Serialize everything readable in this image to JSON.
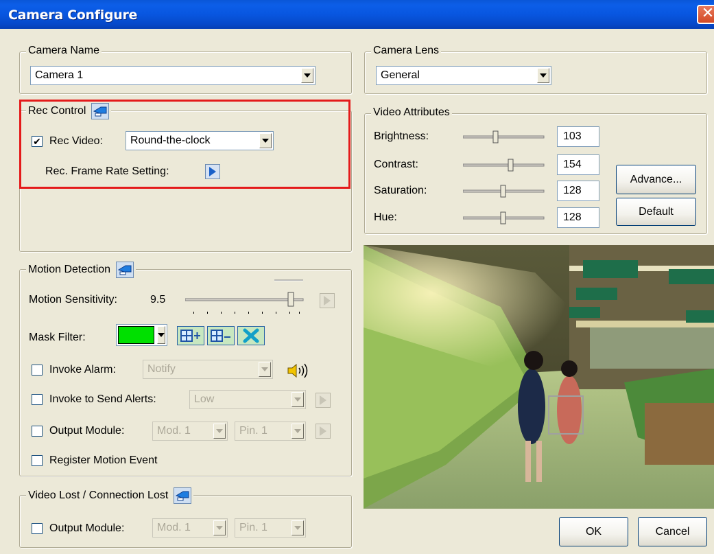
{
  "window": {
    "title": "Camera Configure",
    "close_glyph": "✕"
  },
  "camera_name": {
    "legend": "Camera Name",
    "value": "Camera 1"
  },
  "rec_control": {
    "legend": "Rec Control",
    "rec_video_label": "Rec Video:",
    "rec_video_checked": true,
    "rec_video_value": "Round-the-clock",
    "frame_rate_label": "Rec. Frame Rate Setting:"
  },
  "motion_detection": {
    "legend": "Motion Detection",
    "sensitivity_label": "Motion Sensitivity:",
    "sensitivity_value": "9.5",
    "mask_filter_label": "Mask Filter:",
    "mask_color": "#00e000",
    "invoke_alarm_label": "Invoke Alarm:",
    "invoke_alarm_value": "Notify",
    "send_alerts_label": "Invoke to Send Alerts:",
    "send_alerts_value": "Low",
    "output_module_label": "Output Module:",
    "output_module_value": "Mod. 1",
    "output_pin_value": "Pin. 1",
    "register_label": "Register Motion Event"
  },
  "video_lost": {
    "legend": "Video Lost / Connection Lost",
    "output_module_label": "Output Module:",
    "output_module_value": "Mod. 1",
    "output_pin_value": "Pin. 1"
  },
  "camera_lens": {
    "legend": "Camera Lens",
    "value": "General"
  },
  "video_attributes": {
    "legend": "Video Attributes",
    "rows": [
      {
        "label": "Brightness:",
        "value": "103",
        "level": 0.4
      },
      {
        "label": "Contrast:",
        "value": "154",
        "level": 0.6
      },
      {
        "label": "Saturation:",
        "value": "128",
        "level": 0.5
      },
      {
        "label": "Hue:",
        "value": "128",
        "level": 0.5
      }
    ],
    "advance_label": "Advance...",
    "default_label": "Default"
  },
  "buttons": {
    "ok": "OK",
    "cancel": "Cancel"
  },
  "accent_colors": {
    "titlebar": "#0a56d8",
    "highlight_box": "#e41a1a"
  }
}
